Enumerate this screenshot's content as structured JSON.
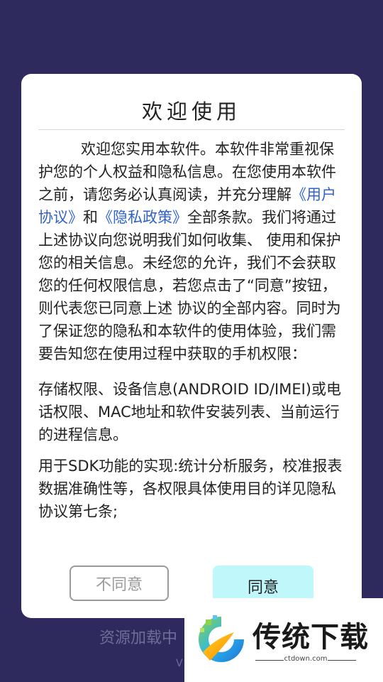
{
  "dialog": {
    "title": "欢迎使用",
    "p1_start": "欢迎您实用本软件。本软件非常重视保护您的个人权益和隐私信息。在您使用本软件之前，请您务必认真阅读，并充分理解",
    "link_user_agreement": "《用户协议》",
    "and": "和",
    "link_privacy_policy": "《隐私政策》",
    "p1_end": "全部条款。我们将通过上述协议向您说明我们如何收集、 使用和保护您的相关信息。未经您的允许，我们不会获取您的任何权限信息，若您点击了“同意”按钮，则代表您已同意上述 协议的全部内容。同时为了保证您的隐私和本软件的使用体验，我们需要告知您在使用过程中获取的手机权限：",
    "p2": "存储权限、设备信息(ANDROID ID/IMEI)或电话权限、MAC地址和软件安装列表、当前运行的进程信息。",
    "p3": "用于SDK功能的实现:统计分析服务，校准报表数据准确性等，各权限具体使用目的详见隐私协议第七条;",
    "disagree_label": "不同意",
    "agree_label": "同意"
  },
  "background": {
    "loading_text": "资源加载中",
    "version_text": "V"
  },
  "watermark": {
    "brand": "传统下载",
    "domain": "ctdown.com"
  },
  "colors": {
    "background": "#2e2a5e",
    "link": "#2f63c9",
    "agree_button": "#bff7fb"
  }
}
